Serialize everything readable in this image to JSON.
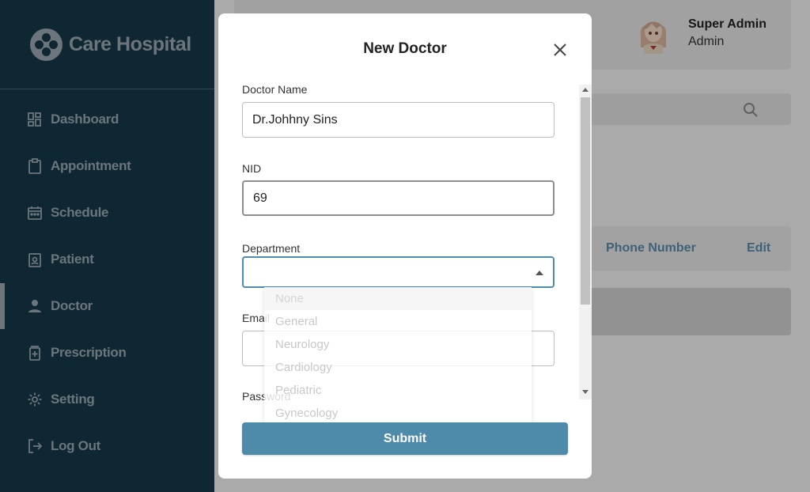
{
  "app": {
    "brand_name": "Care Hospital"
  },
  "sidebar": {
    "items": [
      {
        "label": "Dashboard",
        "icon": "dashboard-icon"
      },
      {
        "label": "Appointment",
        "icon": "clipboard-icon"
      },
      {
        "label": "Schedule",
        "icon": "calendar-icon"
      },
      {
        "label": "Patient",
        "icon": "patient-badge-icon"
      },
      {
        "label": "Doctor",
        "icon": "person-icon"
      },
      {
        "label": "Prescription",
        "icon": "prescription-icon"
      },
      {
        "label": "Setting",
        "icon": "gear-icon"
      },
      {
        "label": "Log Out",
        "icon": "logout-icon"
      }
    ],
    "active": "Doctor"
  },
  "user": {
    "name": "Super Admin",
    "role": "Admin"
  },
  "table": {
    "headers": [
      "Phone Number",
      "Edit"
    ]
  },
  "modal": {
    "title": "New Doctor",
    "fields": {
      "doctor_name": {
        "label": "Doctor Name",
        "value": "Dr.Johhny Sins"
      },
      "nid": {
        "label": "NID",
        "value": "69"
      },
      "department": {
        "label": "Department",
        "value": ""
      },
      "email": {
        "label": "Email",
        "value": ""
      },
      "password": {
        "label": "Password"
      }
    },
    "department_options": [
      "None",
      "General",
      "Neurology",
      "Cardiology",
      "Pediatric",
      "Gynecology"
    ],
    "submit_label": "Submit"
  },
  "colors": {
    "sidebar_bg": "#16384a",
    "sidebar_text": "#9aa8b0",
    "accent": "#4e8bab",
    "select_border": "#4e8bb3"
  }
}
